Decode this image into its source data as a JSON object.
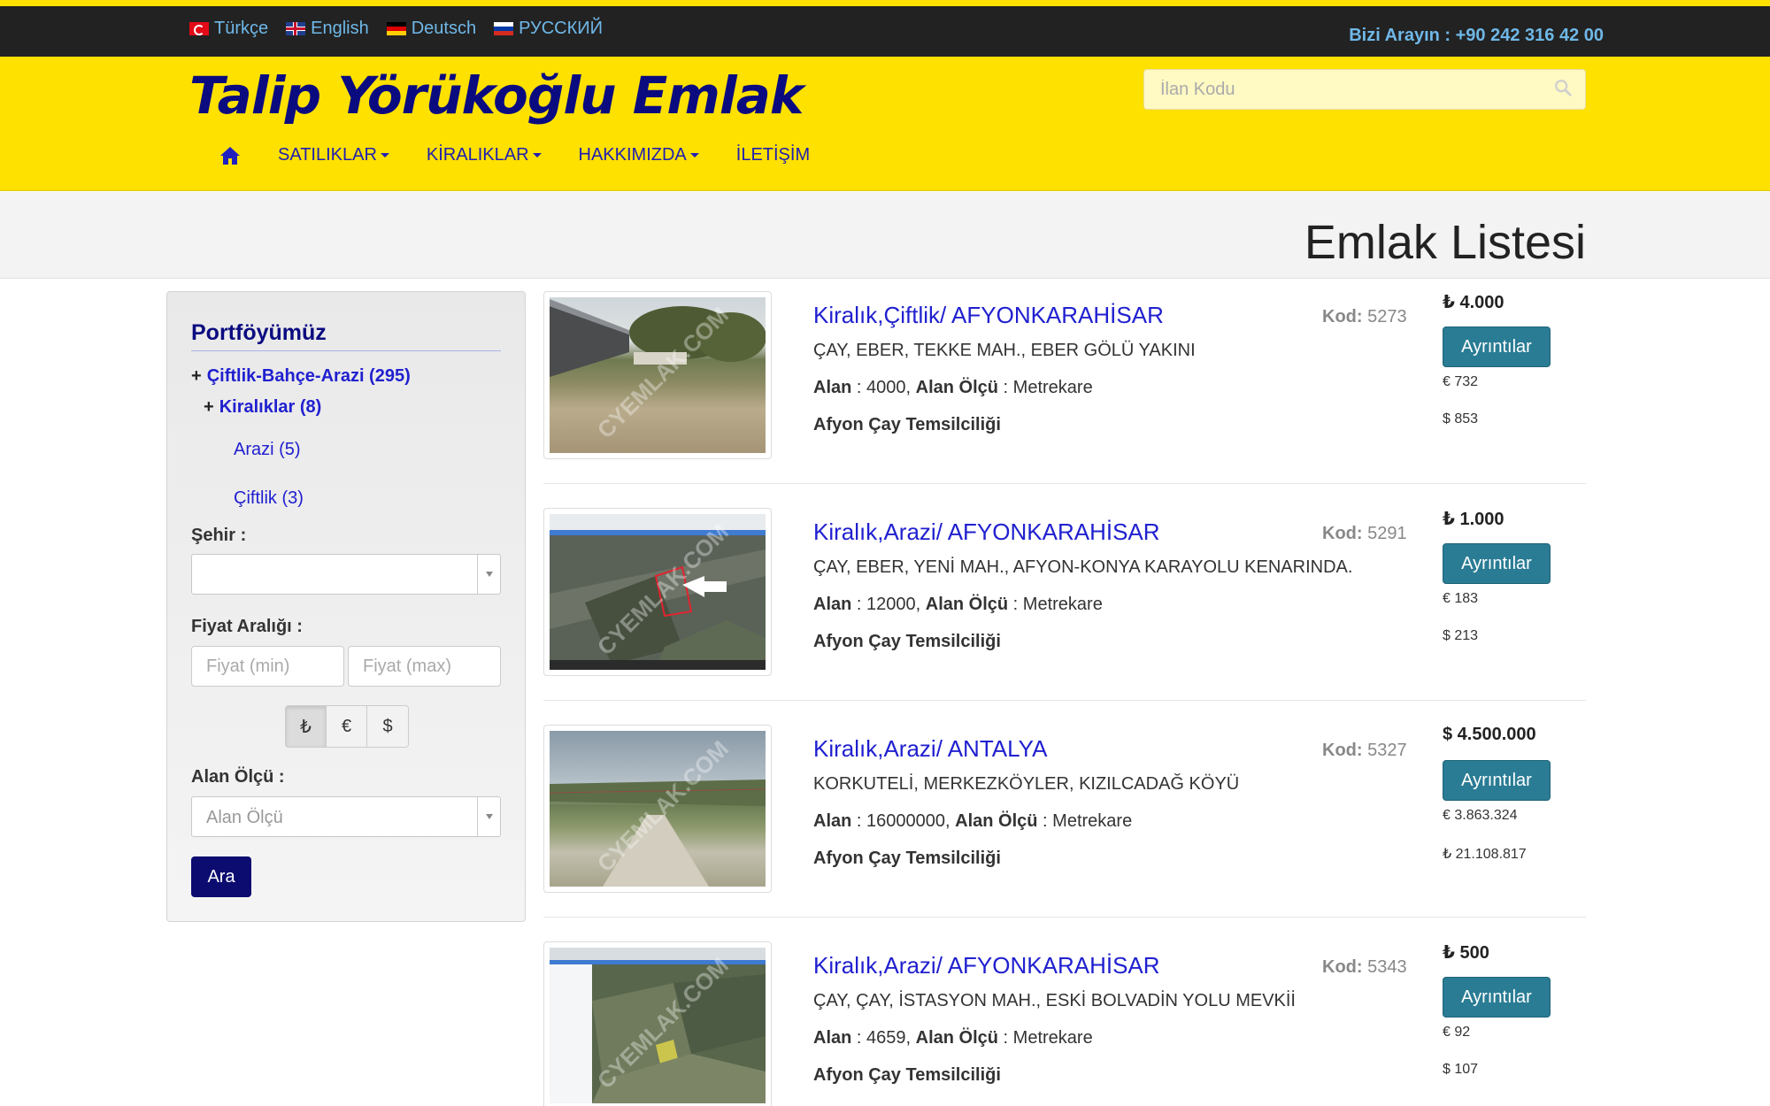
{
  "topbar": {
    "languages": [
      {
        "label": "Türkçe",
        "flag": "turkey-flag-icon"
      },
      {
        "label": "English",
        "flag": "uk-flag-icon"
      },
      {
        "label": "Deutsch",
        "flag": "germany-flag-icon"
      },
      {
        "label": "РУССКИЙ",
        "flag": "russia-flag-icon"
      }
    ],
    "phone": "Bizi Arayın : +90 242 316 42 00"
  },
  "header": {
    "logo": "Talip Yörükoğlu Emlak",
    "search_placeholder": "İlan Kodu",
    "nav": {
      "home_icon": "home-icon",
      "items": [
        "SATILIKLAR",
        "KİRALIKLAR",
        "HAKKIMIZDA",
        "İLETİŞİM"
      ]
    }
  },
  "page": {
    "title": "Emlak Listesi"
  },
  "sidebar": {
    "title": "Portföyümüz",
    "categories": [
      {
        "label": "Çiftlik-Bahçe-Arazi (295)"
      },
      {
        "label": "Kiralıklar (8)"
      }
    ],
    "subcategories": [
      "Arazi (5)",
      "Çiftlik (3)"
    ],
    "city_label": "Şehir :",
    "city_value": "",
    "price_label": "Fiyat Aralığı  :",
    "price_min_placeholder": "Fiyat (min)",
    "price_max_placeholder": "Fiyat (max)",
    "currencies": [
      "₺",
      "€",
      "$"
    ],
    "area_label": "Alan Ölçü :",
    "area_placeholder": "Alan Ölçü",
    "search_button": "Ara"
  },
  "labels": {
    "code": "Kod:",
    "area": "Alan",
    "area_unit": "Alan Ölçü",
    "details_button": "Ayrıntılar"
  },
  "listings": [
    {
      "title": "Kiralık,Çiftlik/ AFYONKARAHİSAR",
      "code": "5273",
      "address": "ÇAY, EBER, TEKKE MAH., EBER GÖLÜ YAKINI",
      "area": "4000",
      "unit": "Metrekare",
      "office": "Afyon Çay Temsilciliği",
      "price": "₺ 4.000",
      "alt1": "€ 732",
      "alt2": "$ 853",
      "watermark": "CYEMLAK.COM"
    },
    {
      "title": "Kiralık,Arazi/ AFYONKARAHİSAR",
      "code": "5291",
      "address": "ÇAY, EBER, YENİ MAH., AFYON-KONYA KARAYOLU KENARINDA.",
      "area": "12000",
      "unit": "Metrekare",
      "office": "Afyon Çay Temsilciliği",
      "price": "₺ 1.000",
      "alt1": "€ 183",
      "alt2": "$ 213",
      "watermark": "CYEMLAK.COM"
    },
    {
      "title": "Kiralık,Arazi/ ANTALYA",
      "code": "5327",
      "address": "KORKUTELİ, MERKEZKÖYLER, KIZILCADAĞ KÖYÜ",
      "area": "16000000",
      "unit": "Metrekare",
      "office": "Afyon Çay Temsilciliği",
      "price": "$ 4.500.000",
      "alt1": "€ 3.863.324",
      "alt2": "₺ 21.108.817",
      "watermark": "CYEMLAK.COM"
    },
    {
      "title": "Kiralık,Arazi/ AFYONKARAHİSAR",
      "code": "5343",
      "address": "ÇAY, ÇAY, İSTASYON MAH., ESKİ BOLVADİN YOLU MEVKİİ",
      "area": "4659",
      "unit": "Metrekare",
      "office": "Afyon Çay Temsilciliği",
      "price": "₺ 500",
      "alt1": "€ 92",
      "alt2": "$ 107",
      "watermark": "CYEMLAK.COM"
    }
  ],
  "colors": {
    "header_yellow": "#ffe100",
    "topbar_dark": "#222222",
    "link_blue": "#2020d0",
    "logo_navy": "#0b0b80",
    "details_teal": "#2a7c94"
  }
}
